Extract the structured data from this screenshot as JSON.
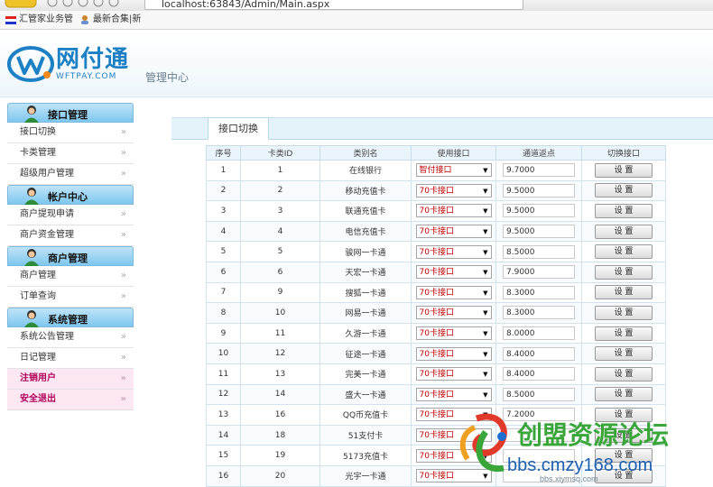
{
  "browser": {
    "url": "localhost:63843/Admin/Main.aspx"
  },
  "bookmarks": [
    {
      "label": "汇管家业务管",
      "icon": "flag-icon"
    },
    {
      "label": "最新合集|新",
      "icon": "user-icon"
    }
  ],
  "header": {
    "brand_cn": "网付通",
    "brand_en": "WFTPAY.COM",
    "subtitle": "管理中心"
  },
  "sidebar": {
    "sections": [
      {
        "title": "接口管理",
        "items": [
          "接口切换",
          "卡类管理",
          "超级用户管理"
        ]
      },
      {
        "title": "帐户中心",
        "items": [
          "商户提现申请",
          "商户资金管理"
        ]
      },
      {
        "title": "商户管理",
        "items": [
          "商户管理",
          "订单查询"
        ]
      },
      {
        "title": "系统管理",
        "items": [
          "系统公告管理",
          "日记管理"
        ]
      }
    ],
    "extra": [
      "注销用户",
      "安全退出"
    ],
    "arrow": "»"
  },
  "main": {
    "tab": "接口切换",
    "columns": [
      "序号",
      "卡类ID",
      "类别名",
      "使用接口",
      "通道返点",
      "切换接口"
    ],
    "button_label": "设 置",
    "rows": [
      {
        "no": "1",
        "id": "1",
        "name": "在线银行",
        "iface": "智付接口",
        "rate": "9.7000"
      },
      {
        "no": "2",
        "id": "2",
        "name": "移动充值卡",
        "iface": "70卡接口",
        "rate": "9.5000"
      },
      {
        "no": "3",
        "id": "3",
        "name": "联通充值卡",
        "iface": "70卡接口",
        "rate": "9.5000"
      },
      {
        "no": "4",
        "id": "4",
        "name": "电信充值卡",
        "iface": "70卡接口",
        "rate": "9.5000"
      },
      {
        "no": "5",
        "id": "5",
        "name": "骏网一卡通",
        "iface": "70卡接口",
        "rate": "8.5000"
      },
      {
        "no": "6",
        "id": "6",
        "name": "天宏一卡通",
        "iface": "70卡接口",
        "rate": "7.9000"
      },
      {
        "no": "7",
        "id": "9",
        "name": "搜狐一卡通",
        "iface": "70卡接口",
        "rate": "8.3000"
      },
      {
        "no": "8",
        "id": "10",
        "name": "网易一卡通",
        "iface": "70卡接口",
        "rate": "8.3000"
      },
      {
        "no": "9",
        "id": "11",
        "name": "久游一卡通",
        "iface": "70卡接口",
        "rate": "8.0000"
      },
      {
        "no": "10",
        "id": "12",
        "name": "征途一卡通",
        "iface": "70卡接口",
        "rate": "8.4000"
      },
      {
        "no": "11",
        "id": "13",
        "name": "完美一卡通",
        "iface": "70卡接口",
        "rate": "8.4000"
      },
      {
        "no": "12",
        "id": "14",
        "name": "盛大一卡通",
        "iface": "70卡接口",
        "rate": "8.5000"
      },
      {
        "no": "13",
        "id": "16",
        "name": "QQ币充值卡",
        "iface": "70卡接口",
        "rate": "7.2000"
      },
      {
        "no": "14",
        "id": "18",
        "name": "51支付卡",
        "iface": "70卡接口",
        "rate": ""
      },
      {
        "no": "15",
        "id": "19",
        "name": "5173充值卡",
        "iface": "70卡接口",
        "rate": ""
      },
      {
        "no": "16",
        "id": "20",
        "name": "光宇一卡通",
        "iface": "70卡接口",
        "rate": ""
      }
    ]
  },
  "watermark": {
    "title": "创盟资源论坛",
    "url": "bbs.cmzy168.com",
    "url2": "bbs.xiymsq.com"
  },
  "colors": {
    "accent": "#1d7fc4",
    "section_bar": "#7fc7ee",
    "select_text": "#c00000",
    "pink_item": "#fde7f2"
  }
}
